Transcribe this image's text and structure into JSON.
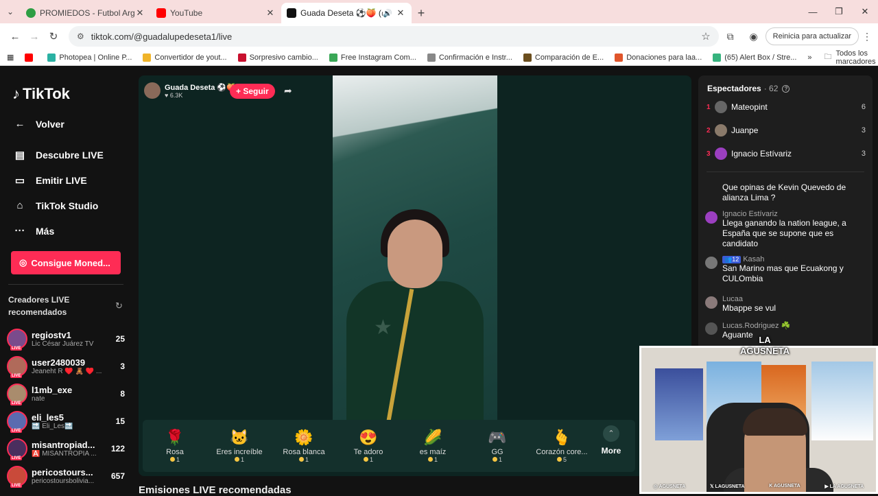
{
  "browser": {
    "tabs": [
      {
        "title": "PROMIEDOS - Futbol Argentino",
        "favicon_color": "#2e9e44",
        "active": false
      },
      {
        "title": "YouTube",
        "favicon_color": "#ff0000",
        "active": false
      },
      {
        "title": "Guada Deseta ⚽🍑 (@gua",
        "favicon_color": "#111111",
        "active": true
      }
    ],
    "url": "tiktok.com/@guadalupedeseta1/live",
    "update_button": "Reinicia para actualizar",
    "bookmarks": [
      {
        "label": "Photopea | Online P...",
        "color": "#2bb1a3"
      },
      {
        "label": "Convertidor de yout...",
        "color": "#f0b429"
      },
      {
        "label": "Sorpresivo cambio...",
        "color": "#c8102e"
      },
      {
        "label": "Free Instagram Com...",
        "color": "#3aa757"
      },
      {
        "label": "Confirmación e Instr...",
        "color": "#888888"
      },
      {
        "label": "Comparación de E...",
        "color": "#6b4e1e"
      },
      {
        "label": "Donaciones para laa...",
        "color": "#e0552b"
      },
      {
        "label": "(65) Alert Box / Stre...",
        "color": "#36b37e"
      }
    ],
    "all_bookmarks": "Todos los marcadores"
  },
  "sidebar": {
    "logo": "TikTok",
    "back": "Volver",
    "nav": [
      {
        "label": "Descubre LIVE",
        "icon": "calendar-icon"
      },
      {
        "label": "Emitir LIVE",
        "icon": "camera-icon"
      },
      {
        "label": "TikTok Studio",
        "icon": "home-icon"
      },
      {
        "label": "Más",
        "icon": "ellipsis-icon"
      }
    ],
    "coins_button": "Consigue Moned...",
    "creators_title": "Creadores LIVE recomendados",
    "live_badge": "LIVE",
    "creators": [
      {
        "name": "regiostv1",
        "sub": "Lic César Juárez TV",
        "count": "25",
        "color": "#7a4b8c"
      },
      {
        "name": "user2480039",
        "sub": "Jeaneht R ♥️ 🧸 ♥️ ...",
        "count": "3",
        "color": "#b06a5a"
      },
      {
        "name": "l1mb_exe",
        "sub": "nate",
        "count": "8",
        "color": "#a98c6d"
      },
      {
        "name": "eli_les5",
        "sub": "🔜 Eli_Les🔜",
        "count": "15",
        "color": "#5a6bb0"
      },
      {
        "name": "misantropiad...",
        "sub": "🅰️ MISANTROPIA ...",
        "count": "122",
        "color": "#4a2e5e"
      },
      {
        "name": "pericostours...",
        "sub": "pericostoursbolivia...",
        "count": "657",
        "color": "#c94a3a"
      }
    ]
  },
  "live": {
    "host_name": "Guada Deseta ⚽🍑",
    "host_likes": "♥ 6.3K",
    "follow_label": "+ Seguir",
    "gifts": [
      {
        "name": "Rosa",
        "icon": "🌹",
        "price": "1"
      },
      {
        "name": "Eres increíble",
        "icon": "🐱",
        "price": "1"
      },
      {
        "name": "Rosa blanca",
        "icon": "🌼",
        "price": "1"
      },
      {
        "name": "Te adoro",
        "icon": "😍",
        "price": "1"
      },
      {
        "name": "es maíz",
        "icon": "🌽",
        "price": "1"
      },
      {
        "name": "GG",
        "icon": "🎮",
        "price": "1"
      },
      {
        "name": "Corazón core...",
        "icon": "🫰",
        "price": "5"
      }
    ],
    "more_label": "More",
    "recommended_title": "Emisiones LIVE recomendadas"
  },
  "chat": {
    "viewers_label": "Espectadores",
    "viewers_count": "· 62",
    "top_viewers": [
      {
        "rank": "1",
        "name": "Mateopint",
        "score": "6",
        "color": "#666666"
      },
      {
        "rank": "2",
        "name": "Juanpe",
        "score": "3",
        "color": "#8a7a6a"
      },
      {
        "rank": "3",
        "name": "Ignacio Estívariz",
        "score": "3",
        "color": "#9b3fc0"
      }
    ],
    "messages": [
      {
        "user": "",
        "text": "Que opinas de Kevin Quevedo de alianza Lima ?",
        "color": "#1e1e1e",
        "badge": ""
      },
      {
        "user": "Ignacio Estívariz",
        "text": "Llega ganando la nation league, a España que se supone que es candidato",
        "color": "#9b3fc0",
        "badge": ""
      },
      {
        "user": "Kasah",
        "text": "San Marino mas que Ecuakong y CULOmbia",
        "color": "#777777",
        "badge": "👥12"
      },
      {
        "user": "Lucaa",
        "text": "Mbappe se vul",
        "color": "#8a7a7a",
        "badge": ""
      },
      {
        "user": "Lucas.Rodriguez ☘️",
        "text": "Aguante",
        "color": "#555555",
        "badge": ""
      }
    ]
  },
  "webcam": {
    "logo_top": "LA",
    "logo_bottom": "AGUSNETA",
    "socials": [
      "◎ AGUSNETA",
      "𝕏 LAGUSNETA",
      "K AGUSNETA",
      "▶ LA AGUSNETA"
    ]
  }
}
